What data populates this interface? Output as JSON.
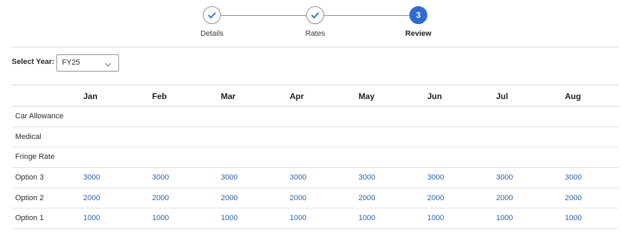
{
  "stepper": {
    "steps": [
      {
        "label": "Details",
        "state": "done"
      },
      {
        "label": "Rates",
        "state": "done"
      },
      {
        "label": "Review",
        "state": "current",
        "number": "3"
      }
    ],
    "accent_color": "#2f6bd3"
  },
  "year_selector": {
    "label": "Select Year:",
    "value": "FY25"
  },
  "table": {
    "columns": [
      "Jan",
      "Feb",
      "Mar",
      "Apr",
      "May",
      "Jun",
      "Jul",
      "Aug"
    ],
    "rows": [
      {
        "label": "Car Allowance",
        "values": [
          "",
          "",
          "",
          "",
          "",
          "",
          "",
          ""
        ]
      },
      {
        "label": "Medical",
        "values": [
          "",
          "",
          "",
          "",
          "",
          "",
          "",
          ""
        ]
      },
      {
        "label": "Fringe Rate",
        "values": [
          "",
          "",
          "",
          "",
          "",
          "",
          "",
          ""
        ]
      },
      {
        "label": "Option 3",
        "values": [
          "3000",
          "3000",
          "3000",
          "3000",
          "3000",
          "3000",
          "3000",
          "3000"
        ]
      },
      {
        "label": "Option 2",
        "values": [
          "2000",
          "2000",
          "2000",
          "2000",
          "2000",
          "2000",
          "2000",
          "2000"
        ]
      },
      {
        "label": "Option 1",
        "values": [
          "1000",
          "1000",
          "1000",
          "1000",
          "1000",
          "1000",
          "1000",
          "1000"
        ]
      }
    ],
    "link_color": "#2f62a8"
  }
}
